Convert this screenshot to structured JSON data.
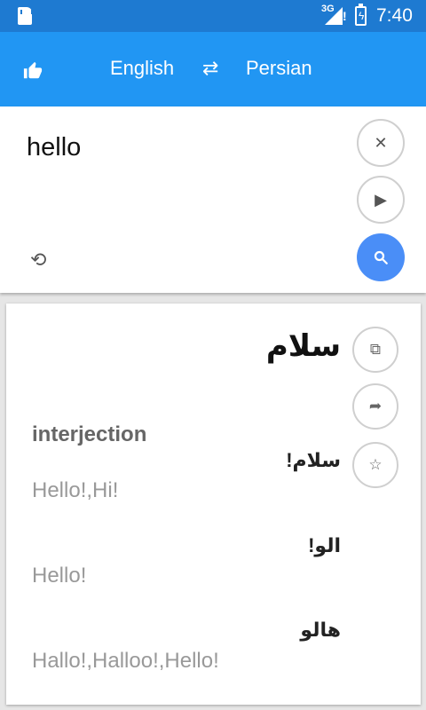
{
  "status_bar": {
    "network_label": "3G",
    "signal_alert": "!",
    "battery_icon": "battery-charging-icon",
    "time": "7:40"
  },
  "toolbar": {
    "source_language": "English",
    "swap_symbol": "⇄",
    "target_language": "Persian",
    "rate_icon": "thumbs-up-icon"
  },
  "input": {
    "text": "hello",
    "clear_symbol": "✕",
    "play_symbol": "▶",
    "search_symbol": "search-icon",
    "history_symbol": "⟲"
  },
  "result": {
    "main_translation": "سلام",
    "part_of_speech": "interjection",
    "entries": [
      {
        "word": "سلام!",
        "meaning": "Hello!,Hi!"
      },
      {
        "word": "الو!",
        "meaning": "Hello!"
      },
      {
        "word": "هالو",
        "meaning": "Hallo!,Halloo!,Hello!"
      }
    ],
    "copy_symbol": "⧉",
    "share_symbol": "➦",
    "star_symbol": "☆"
  },
  "colors": {
    "status_bar": "#1e7ad1",
    "toolbar": "#2196f3",
    "search_button": "#4a8ef7",
    "background": "#e6e6e6"
  }
}
